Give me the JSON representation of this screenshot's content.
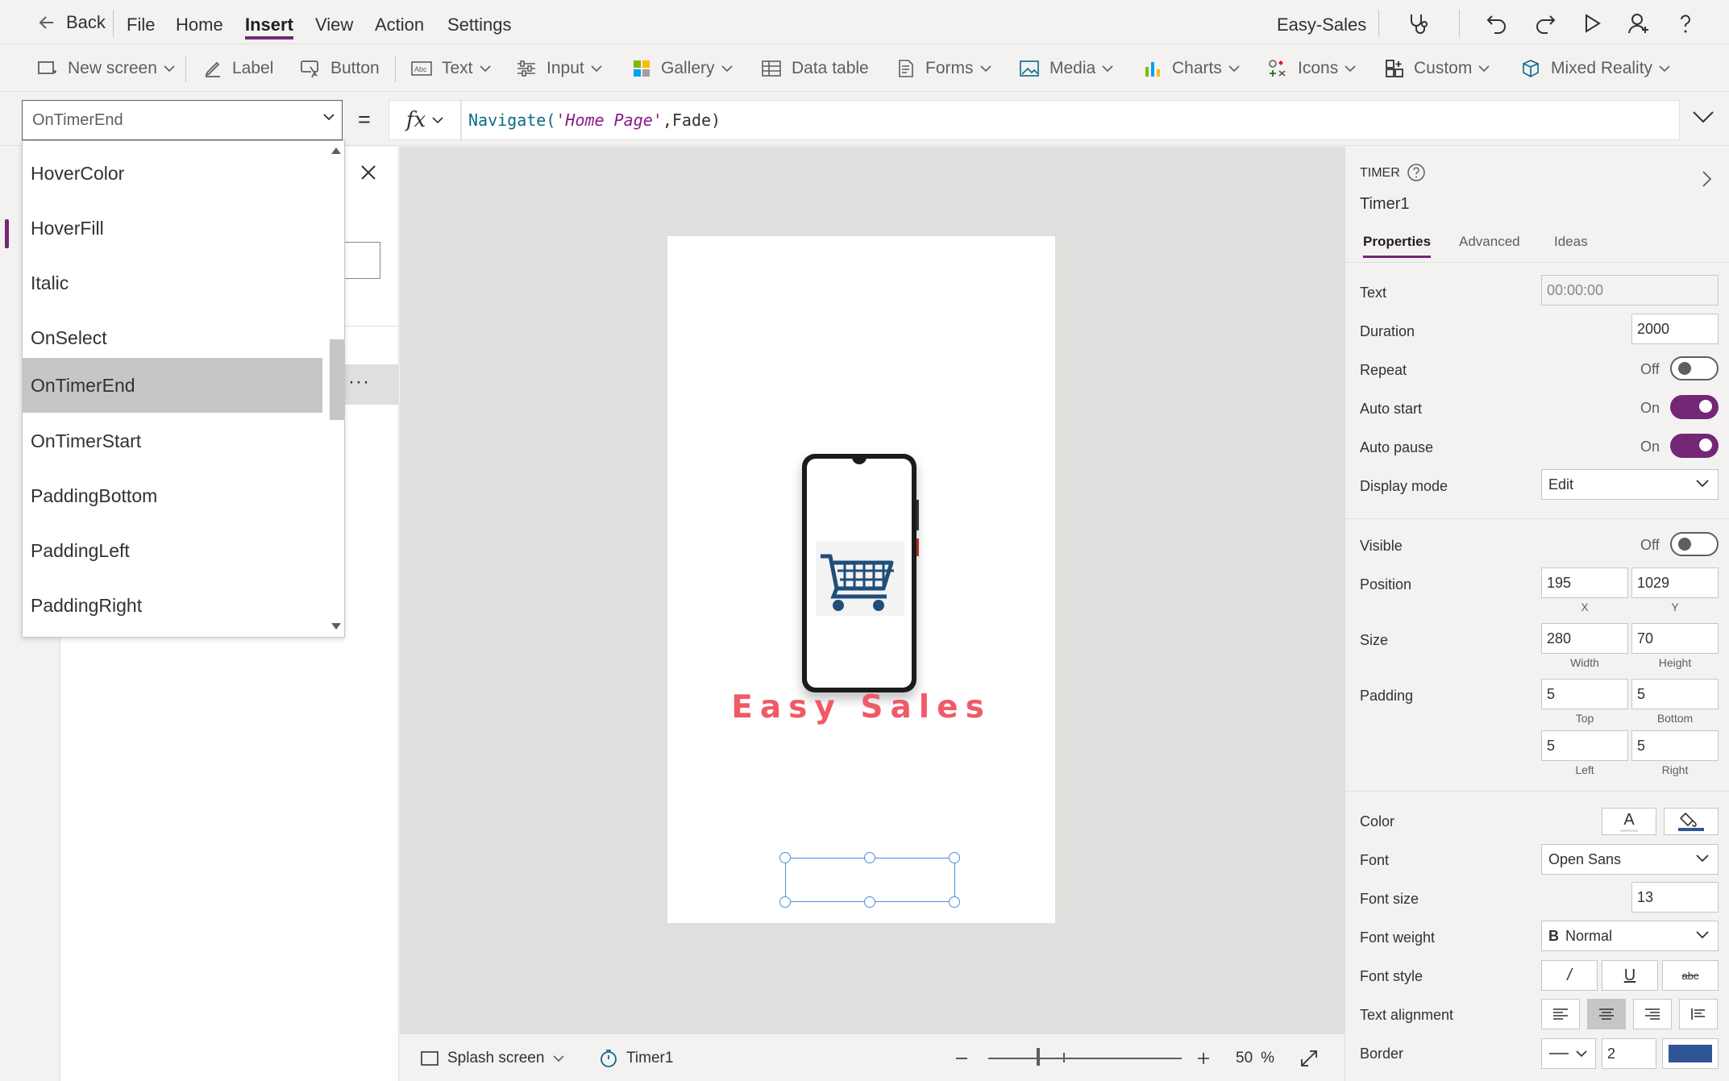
{
  "menubar": {
    "back": "Back",
    "items": [
      "File",
      "Home",
      "Insert",
      "View",
      "Action",
      "Settings"
    ],
    "app_name": "Easy-Sales"
  },
  "ribbon": {
    "new_screen": "New screen",
    "label": "Label",
    "button": "Button",
    "text": "Text",
    "input": "Input",
    "gallery": "Gallery",
    "data_table": "Data table",
    "forms": "Forms",
    "media": "Media",
    "charts": "Charts",
    "icons": "Icons",
    "custom": "Custom",
    "mixed_reality": "Mixed Reality"
  },
  "formula": {
    "property": "OnTimerEnd",
    "equals": "=",
    "fx": "fx",
    "fn": "Navigate(",
    "arg": "'Home Page'",
    "rest": ",Fade)"
  },
  "property_list": {
    "items": [
      "HoverColor",
      "HoverFill",
      "Italic",
      "OnSelect",
      "OnTimerEnd",
      "OnTimerStart",
      "PaddingBottom",
      "PaddingLeft",
      "PaddingRight"
    ],
    "selected": "OnTimerEnd"
  },
  "canvas": {
    "brand_title": "Easy Sales"
  },
  "statusbar": {
    "screen": "Splash screen",
    "control": "Timer1",
    "zoom_value": "50",
    "zoom_unit": "%"
  },
  "panel": {
    "type": "TIMER",
    "name": "Timer1",
    "tabs": [
      "Properties",
      "Advanced",
      "Ideas"
    ],
    "text_label": "Text",
    "text_value": "00:00:00",
    "duration_label": "Duration",
    "duration_value": "2000",
    "repeat_label": "Repeat",
    "repeat_state": "Off",
    "autostart_label": "Auto start",
    "autostart_state": "On",
    "autopause_label": "Auto pause",
    "autopause_state": "On",
    "displaymode_label": "Display mode",
    "displaymode_value": "Edit",
    "visible_label": "Visible",
    "visible_state": "Off",
    "position_label": "Position",
    "position_x": "195",
    "position_y": "1029",
    "x_label": "X",
    "y_label": "Y",
    "size_label": "Size",
    "width_value": "280",
    "height_value": "70",
    "width_label": "Width",
    "height_label": "Height",
    "padding_label": "Padding",
    "padding_top": "5",
    "padding_bottom": "5",
    "padding_left": "5",
    "padding_right": "5",
    "top_label": "Top",
    "bottom_label": "Bottom",
    "left_label": "Left",
    "right_label": "Right",
    "color_label": "Color",
    "color_text_glyph": "A",
    "font_label": "Font",
    "font_value": "Open Sans",
    "fontsize_label": "Font size",
    "fontsize_value": "13",
    "fontweight_label": "Font weight",
    "fontweight_glyph": "B",
    "fontweight_value": "Normal",
    "fontstyle_label": "Font style",
    "italic_glyph": "/",
    "underline_glyph": "U",
    "strike_glyph": "abc",
    "textalign_label": "Text alignment",
    "border_label": "Border",
    "border_width": "2",
    "border_color": "#2f5597"
  },
  "colors": {
    "accent": "#742774",
    "selection": "#4a90d9",
    "brand_title": "#f05a67",
    "cart_blue": "#1f4e79"
  }
}
